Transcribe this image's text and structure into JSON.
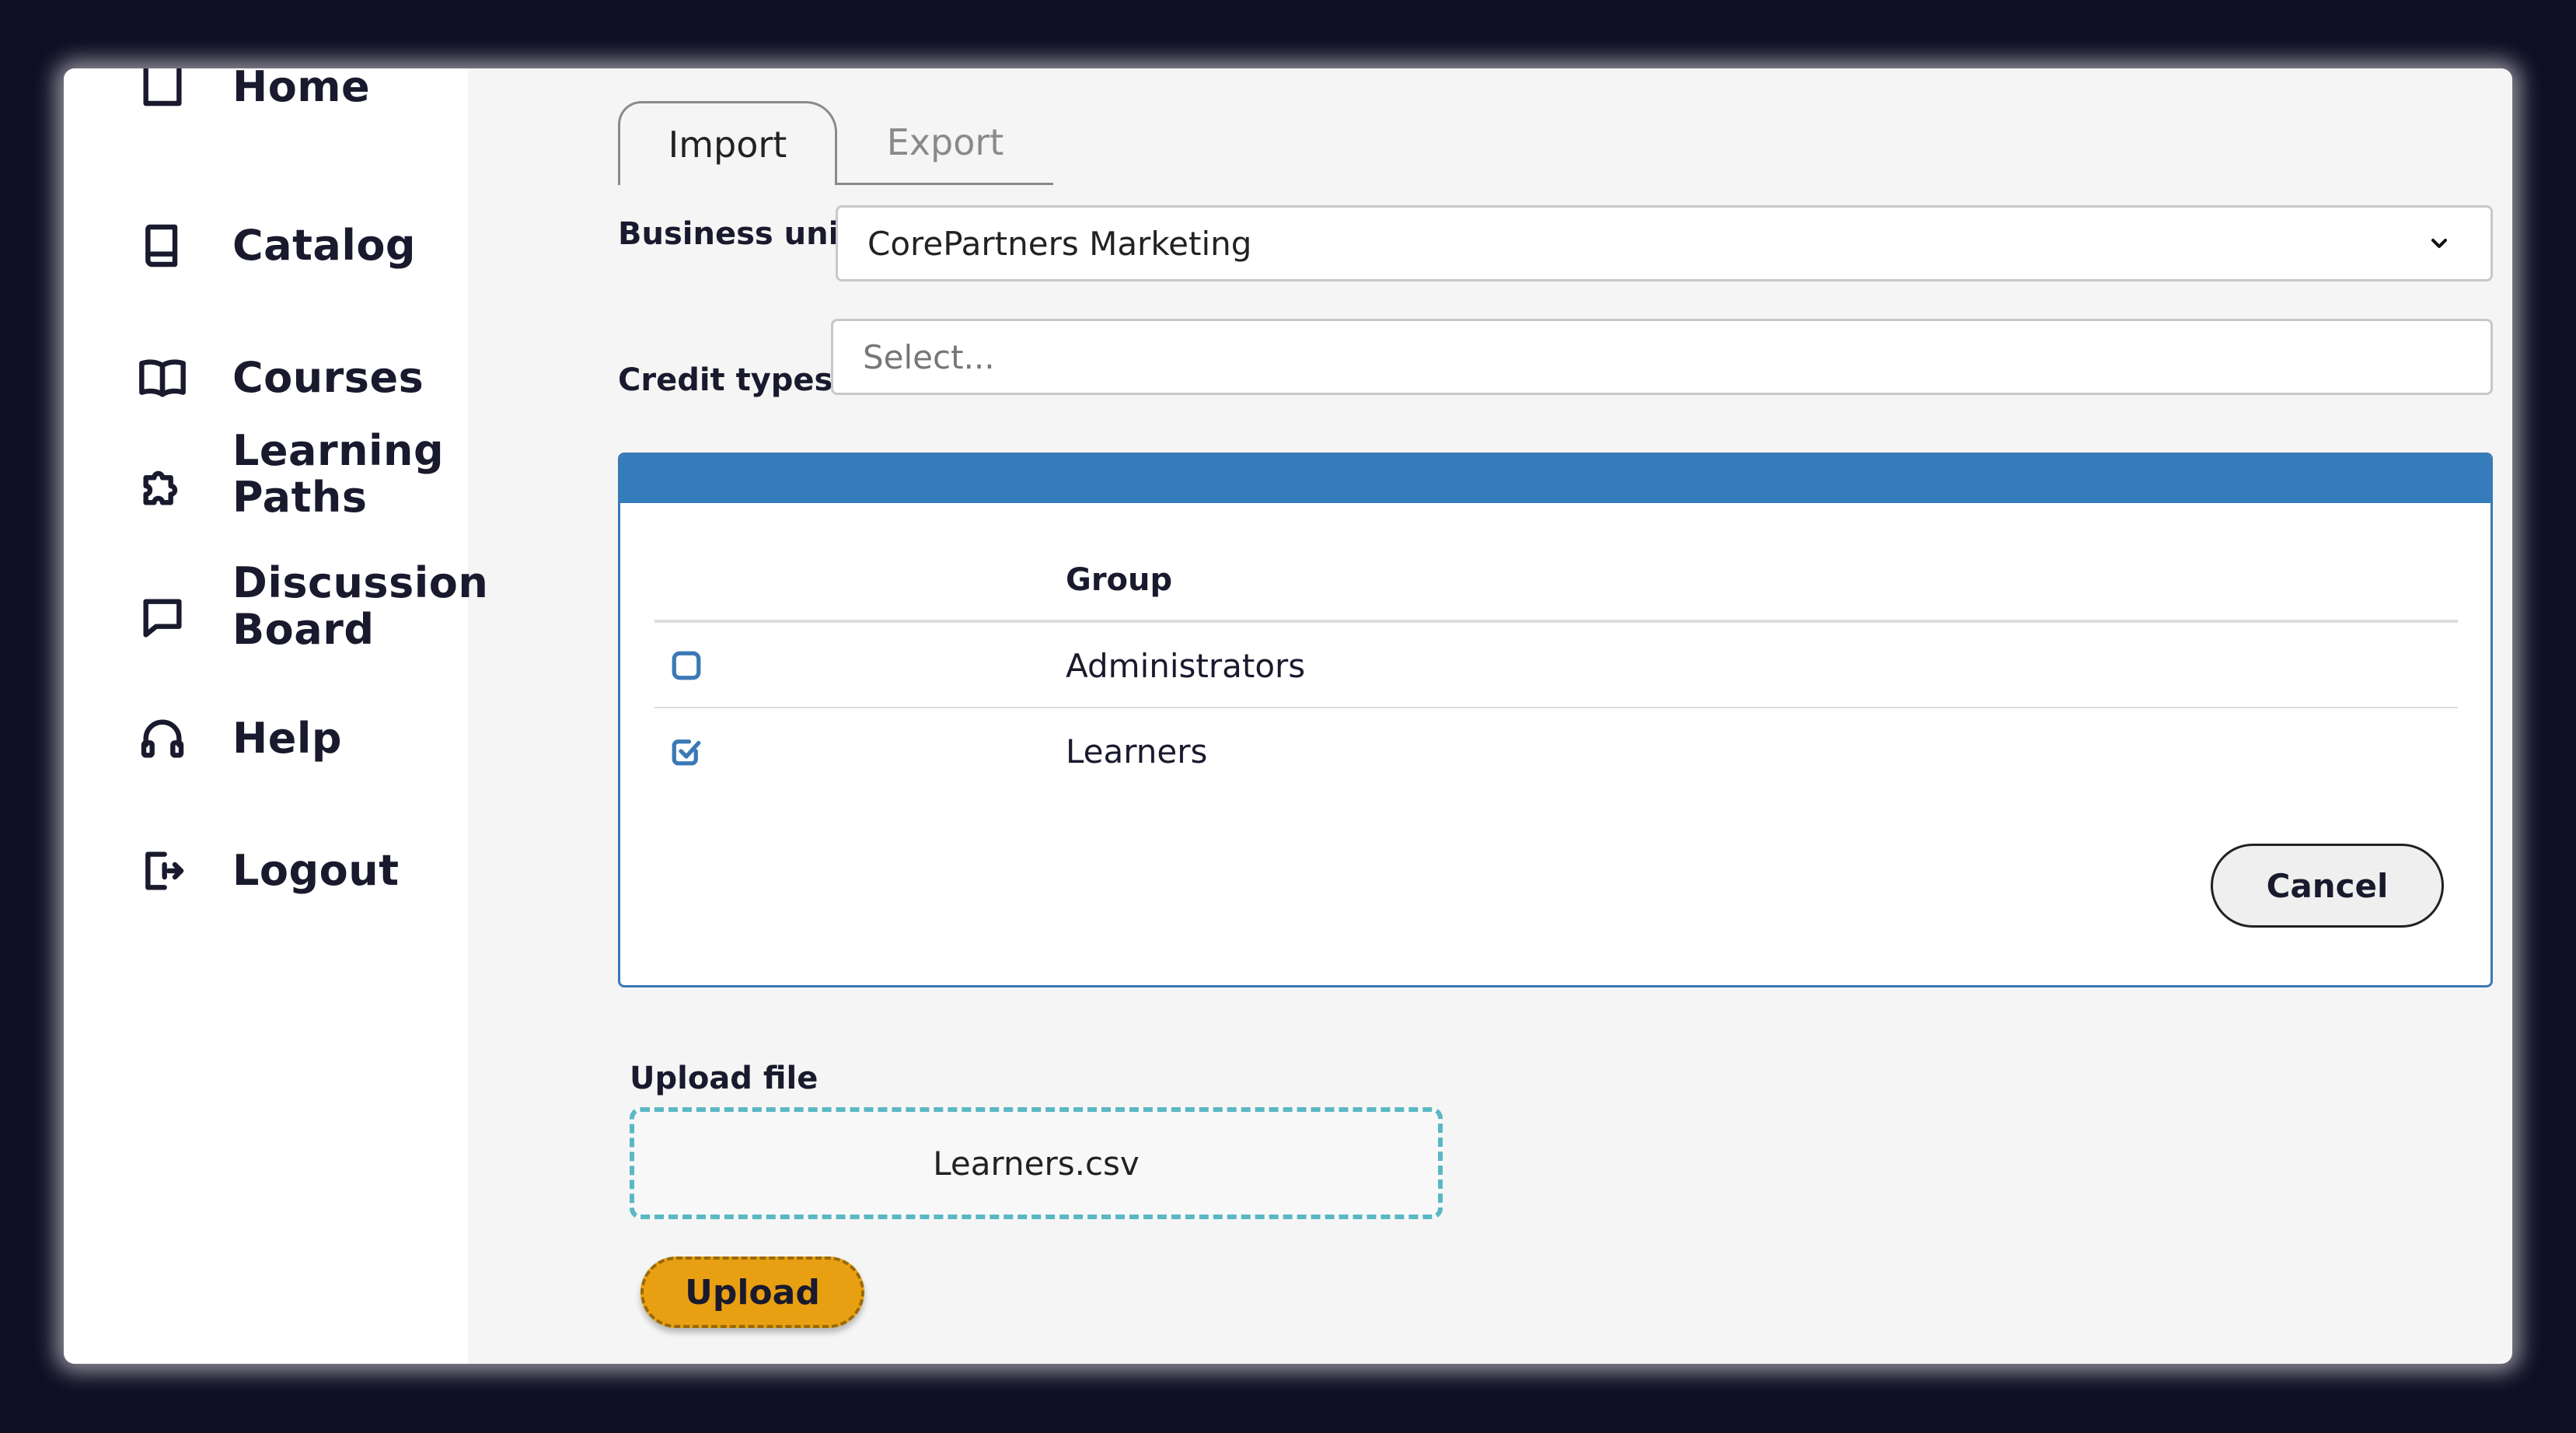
{
  "sidebar": {
    "items": [
      {
        "label": "Home",
        "icon": "home-icon"
      },
      {
        "label": "Catalog",
        "icon": "book-icon"
      },
      {
        "label": "Courses",
        "icon": "open-book-icon"
      },
      {
        "label": "Learning Paths",
        "icon": "puzzle-icon"
      },
      {
        "label": "Discussion Board",
        "icon": "chat-icon"
      },
      {
        "label": "Help",
        "icon": "headset-icon"
      },
      {
        "label": "Logout",
        "icon": "logout-icon"
      }
    ]
  },
  "tabs": [
    {
      "label": "Import",
      "active": true
    },
    {
      "label": "Export",
      "active": false
    }
  ],
  "form": {
    "business_unit_label": "Business unit",
    "business_unit_value": "CorePartners Marketing",
    "credit_types_label": "Credit types",
    "credit_types_placeholder": "Select..."
  },
  "groups": {
    "column_header": "Group",
    "rows": [
      {
        "name": "Administrators",
        "checked": false
      },
      {
        "name": "Learners",
        "checked": true
      }
    ],
    "cancel_label": "Cancel"
  },
  "upload": {
    "label": "Upload file",
    "file_name": "Learners.csv",
    "button_label": "Upload"
  },
  "colors": {
    "panel_header": "#357cba",
    "checkbox": "#3a79b5",
    "dropzone_border": "#5ab8c4",
    "upload_button": "#e8a012"
  }
}
